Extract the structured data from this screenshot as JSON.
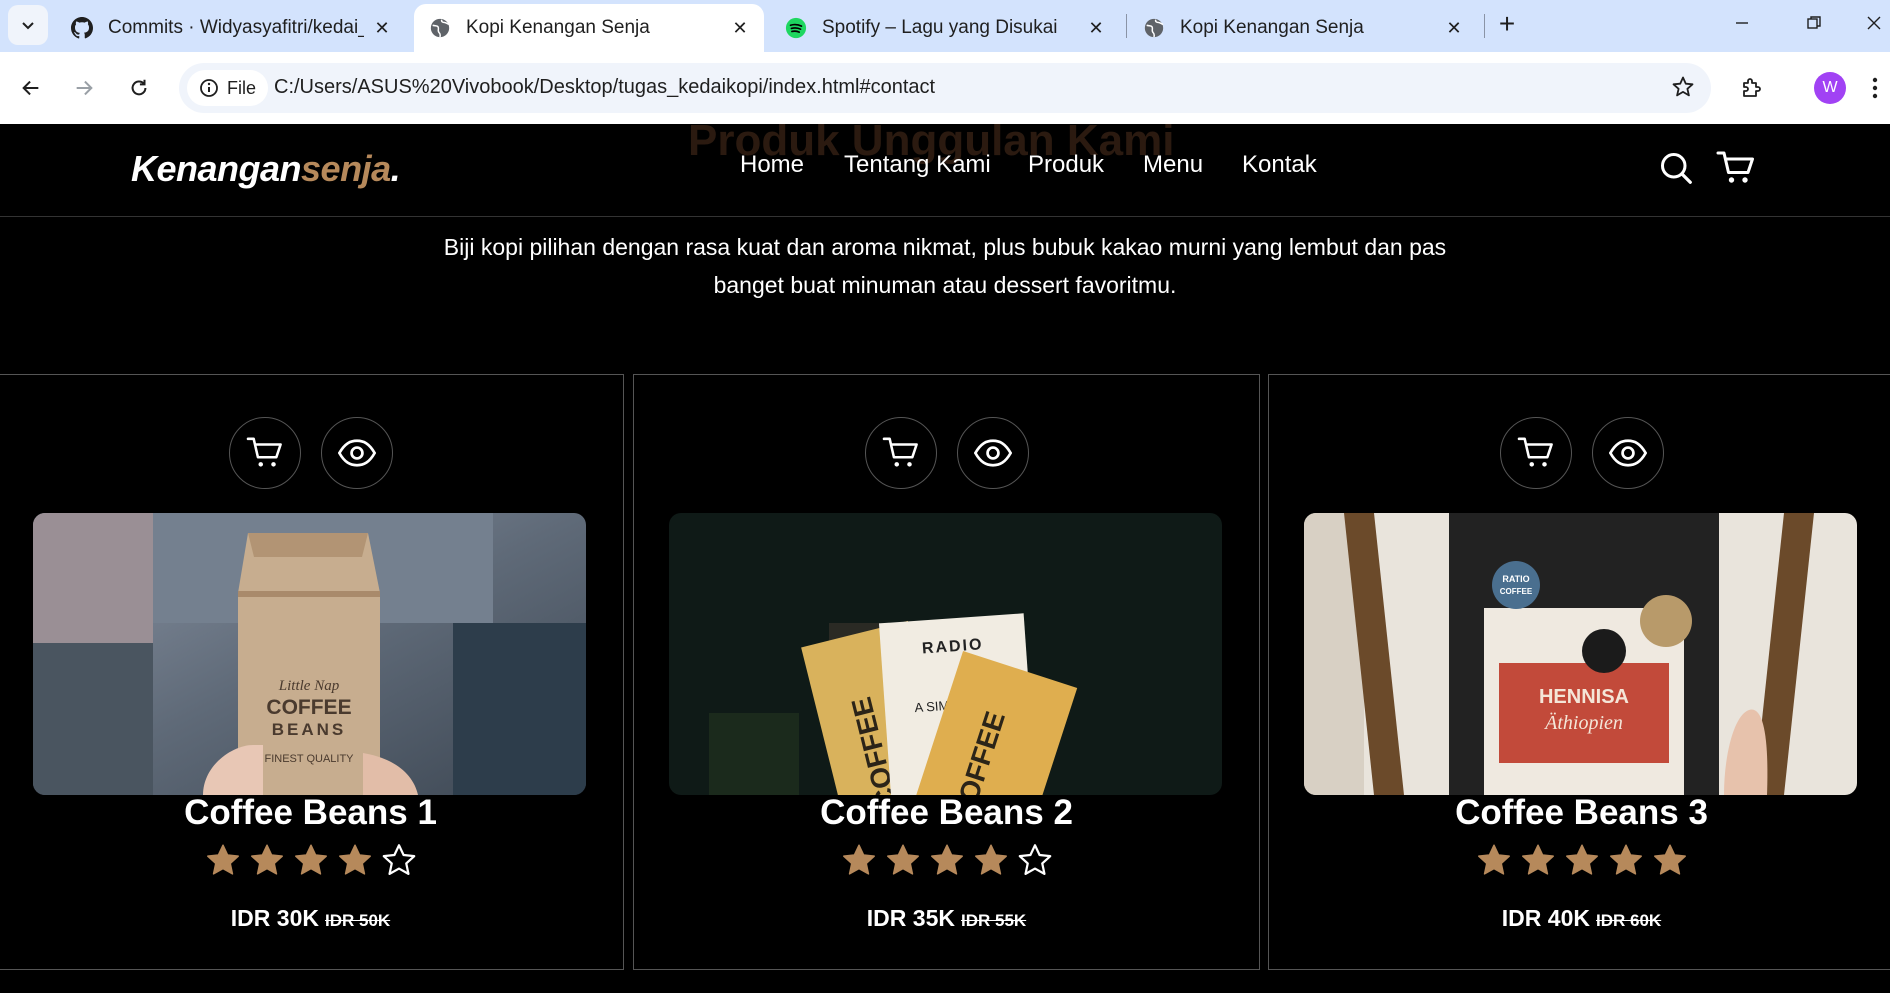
{
  "browser": {
    "tabs": [
      {
        "label": "Commits · Widyasyafitri/kedai_k",
        "icon": "github-icon"
      },
      {
        "label": "Kopi Kenangan Senja",
        "icon": "globe-icon",
        "active": true
      },
      {
        "label": "Spotify – Lagu yang Disukai",
        "icon": "spotify-icon"
      },
      {
        "label": "Kopi Kenangan Senja",
        "icon": "globe-icon"
      }
    ],
    "close_glyph": "✕",
    "new_tab_glyph": "+",
    "window_controls": {
      "minimize": "—",
      "restore": "❐",
      "close": "✕"
    },
    "site_info_label": "File",
    "url": "C:/Users/ASUS%20Vivobook/Desktop/tugas_kedaikopi/index.html#contact",
    "profile_initial": "W"
  },
  "site": {
    "logo_main": "Kenangan",
    "logo_accent": "senja",
    "logo_dot": ".",
    "ghost_heading": "Produk Unggulan Kami",
    "nav": [
      "Home",
      "Tentang Kami",
      "Produk",
      "Menu",
      "Kontak"
    ],
    "subtitle": "Biji kopi pilihan dengan rasa kuat dan aroma nikmat, plus bubuk kakao murni yang lembut dan pas banget buat minuman atau dessert favoritmu.",
    "accent_color": "#b6895b"
  },
  "products": [
    {
      "title": "Coffee Beans 1",
      "rating": 4,
      "max_rating": 5,
      "price": "IDR 30K",
      "old_price": "IDR 50K",
      "image_label_1": "Little Nap",
      "image_label_2": "COFFEE",
      "image_label_3": "BEANS",
      "image_label_4": "FINEST QUALITY"
    },
    {
      "title": "Coffee Beans 2",
      "rating": 4,
      "max_rating": 5,
      "price": "IDR 35K",
      "old_price": "IDR 55K",
      "image_label_1": "RADIO",
      "image_label_2": "A SIMPL",
      "image_label_3": "COFFEE",
      "image_label_4": "COFFEE"
    },
    {
      "title": "Coffee Beans 3",
      "rating": 5,
      "max_rating": 5,
      "price": "IDR 40K",
      "old_price": "IDR 60K",
      "image_label_1": "HENNISA",
      "image_label_2": "Äthiopien",
      "image_label_3": "RATIO",
      "image_label_4": "COFFEE"
    }
  ]
}
